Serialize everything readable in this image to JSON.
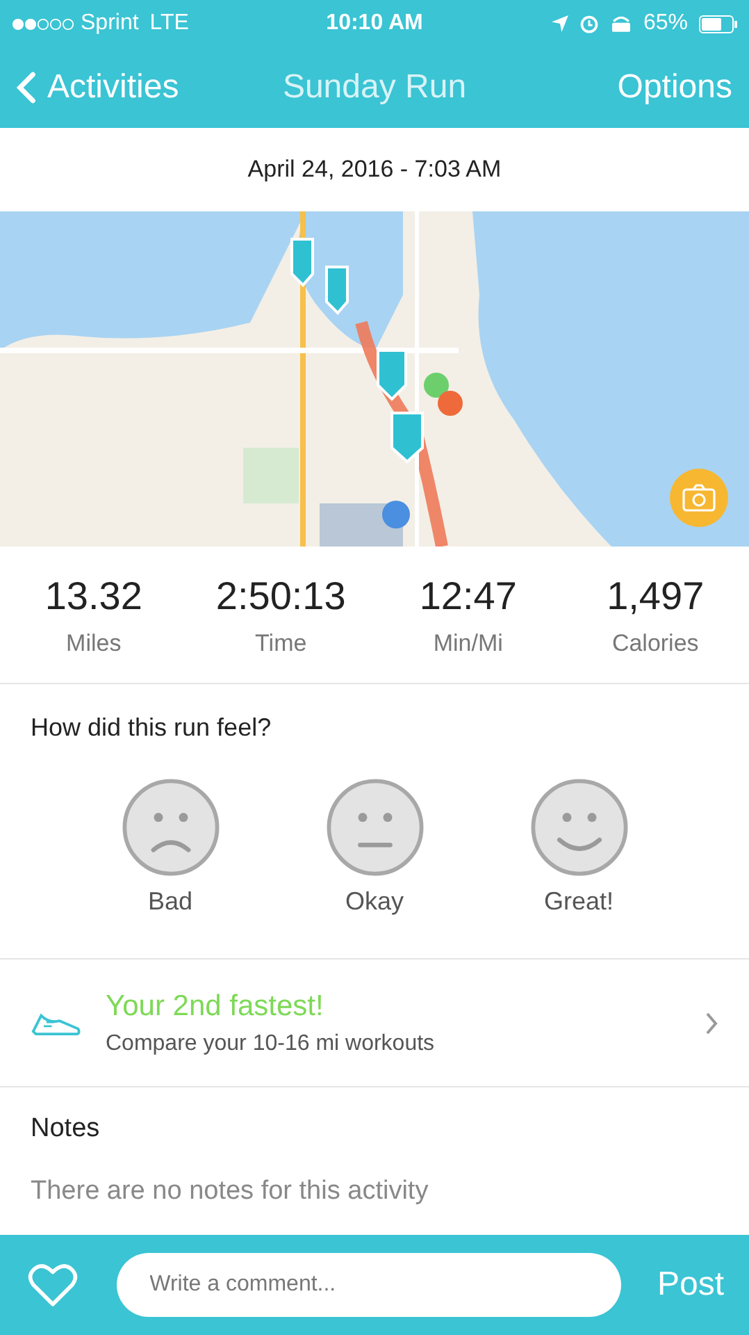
{
  "status_bar": {
    "carrier": "Sprint",
    "network": "LTE",
    "time": "10:10 AM",
    "battery": "65%"
  },
  "nav": {
    "back": "Activities",
    "title": "Sunday Run",
    "action": "Options"
  },
  "date": "April 24, 2016 - 7:03 AM",
  "stats": [
    {
      "value": "13.32",
      "label": "Miles"
    },
    {
      "value": "2:50:13",
      "label": "Time"
    },
    {
      "value": "12:47",
      "label": "Min/Mi"
    },
    {
      "value": "1,497",
      "label": "Calories"
    }
  ],
  "feel": {
    "question": "How did this run feel?",
    "options": [
      {
        "kind": "sad",
        "label": "Bad",
        "selected": false
      },
      {
        "kind": "neutral",
        "label": "Okay",
        "selected": false
      },
      {
        "kind": "happy",
        "label": "Great!",
        "selected": false
      }
    ]
  },
  "achievement": {
    "title": "Your 2nd fastest!",
    "subtitle": "Compare your 10-16 mi workouts"
  },
  "notes": {
    "heading": "Notes",
    "text": "There are no notes for this activity"
  },
  "comment_bar": {
    "placeholder": "Write a comment...",
    "button": "Post"
  }
}
